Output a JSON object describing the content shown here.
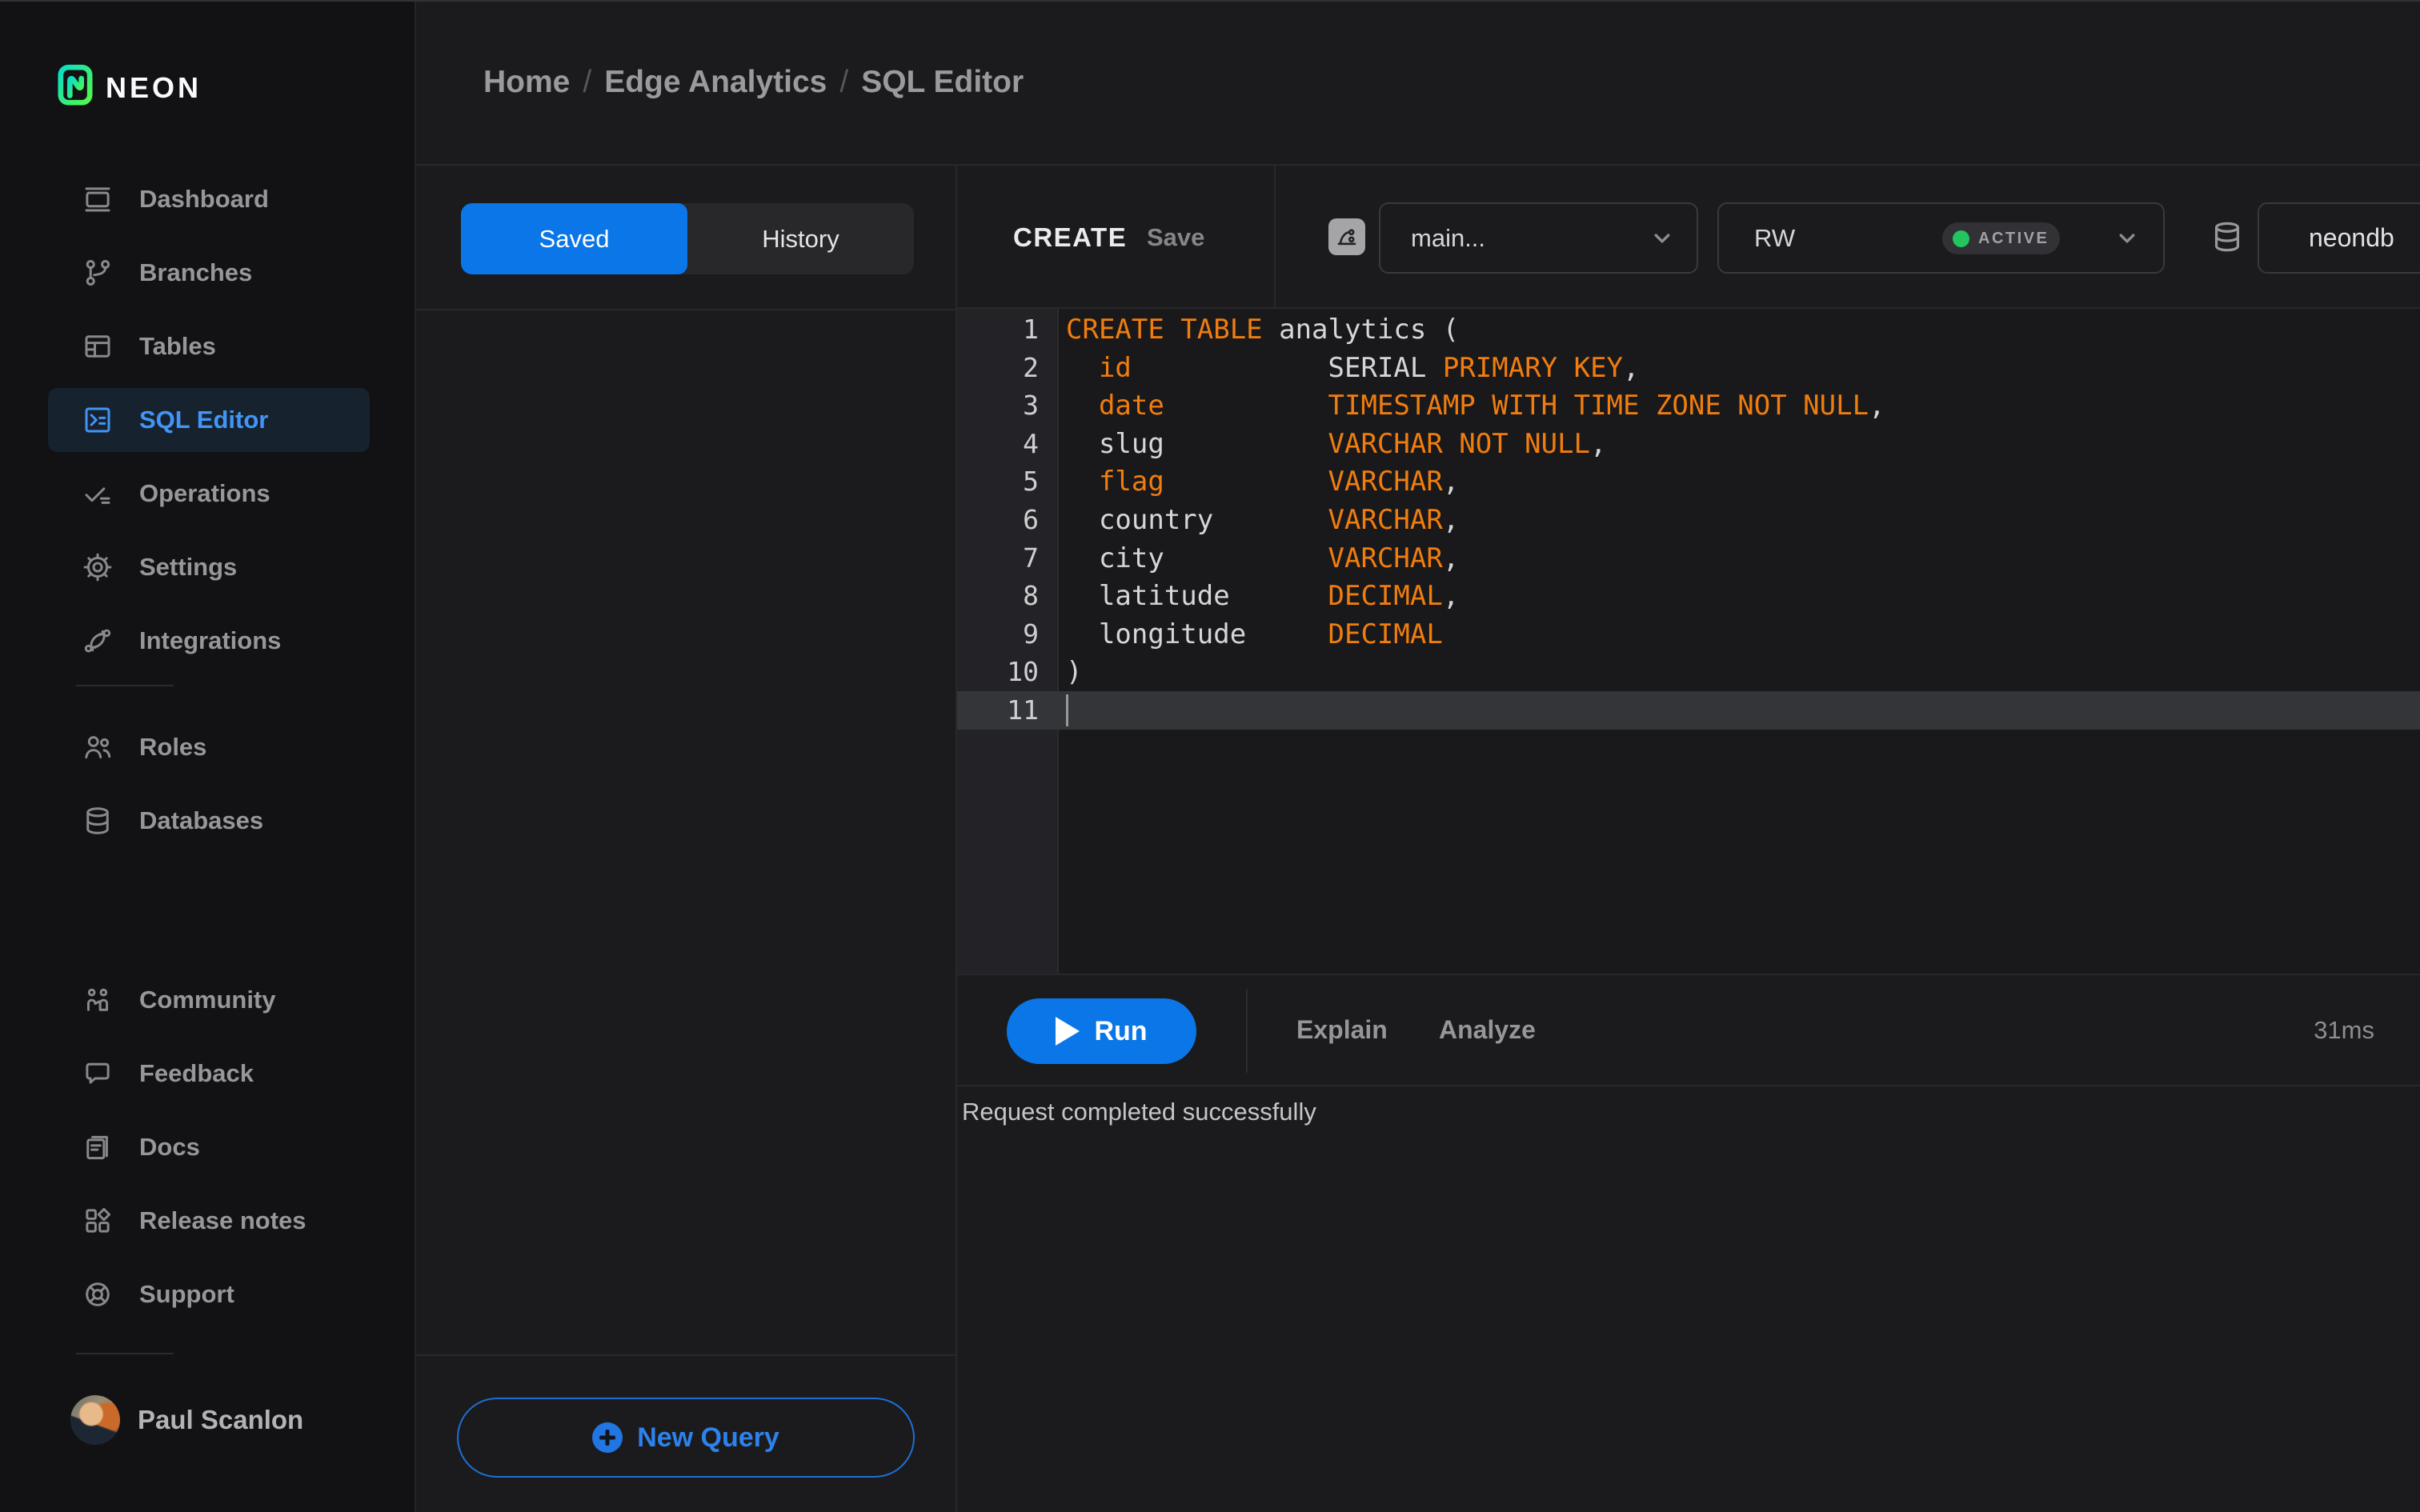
{
  "brand": {
    "name": "NEON"
  },
  "breadcrumb": {
    "separator": "/",
    "items": [
      "Home",
      "Edge Analytics",
      "SQL Editor"
    ]
  },
  "sidebar": {
    "groups": [
      {
        "items": [
          {
            "icon": "dashboard",
            "label": "Dashboard",
            "selected": false
          },
          {
            "icon": "git-branch",
            "label": "Branches",
            "selected": false
          },
          {
            "icon": "table",
            "label": "Tables",
            "selected": false
          },
          {
            "icon": "terminal",
            "label": "SQL Editor",
            "selected": true
          },
          {
            "icon": "check-list",
            "label": "Operations",
            "selected": false
          },
          {
            "icon": "gear",
            "label": "Settings",
            "selected": false
          },
          {
            "icon": "sync-nodes",
            "label": "Integrations",
            "selected": false
          }
        ]
      },
      {
        "items": [
          {
            "icon": "users",
            "label": "Roles",
            "selected": false
          },
          {
            "icon": "database",
            "label": "Databases",
            "selected": false
          }
        ]
      },
      {
        "items": [
          {
            "icon": "community",
            "label": "Community",
            "selected": false
          },
          {
            "icon": "speech-bubble",
            "label": "Feedback",
            "selected": false
          },
          {
            "icon": "document",
            "label": "Docs",
            "selected": false
          },
          {
            "icon": "grid-tiles",
            "label": "Release notes",
            "selected": false
          },
          {
            "icon": "life-buoy",
            "label": "Support",
            "selected": false
          }
        ]
      }
    ],
    "user": {
      "name": "Paul Scanlon"
    }
  },
  "left_panel": {
    "tabs": [
      {
        "label": "Saved",
        "active": true
      },
      {
        "label": "History",
        "active": false
      }
    ],
    "new_query_label": "New Query"
  },
  "toolbar": {
    "query_tab": "CREATE",
    "save_label": "Save",
    "branch": "main...",
    "compute": "RW",
    "compute_status": "ACTIVE",
    "database": "neondb"
  },
  "editor": {
    "lines": [
      {
        "no": 1,
        "segments": [
          {
            "text": "CREATE TABLE",
            "type": "kw"
          },
          {
            "text": " analytics (",
            "type": "pl"
          }
        ]
      },
      {
        "no": 2,
        "segments": [
          {
            "text": "  ",
            "type": "pl"
          },
          {
            "text": "id",
            "type": "kw"
          },
          {
            "text": "            ",
            "type": "pl"
          },
          {
            "text": "SERIAL ",
            "type": "pl"
          },
          {
            "text": "PRIMARY KEY",
            "type": "kw"
          },
          {
            "text": ",",
            "type": "pl"
          }
        ]
      },
      {
        "no": 3,
        "segments": [
          {
            "text": "  ",
            "type": "pl"
          },
          {
            "text": "date",
            "type": "kw"
          },
          {
            "text": "          ",
            "type": "pl"
          },
          {
            "text": "TIMESTAMP WITH TIME ZONE NOT NULL",
            "type": "kw"
          },
          {
            "text": ",",
            "type": "pl"
          }
        ]
      },
      {
        "no": 4,
        "segments": [
          {
            "text": "  slug          ",
            "type": "pl"
          },
          {
            "text": "VARCHAR NOT NULL",
            "type": "kw"
          },
          {
            "text": ",",
            "type": "pl"
          }
        ]
      },
      {
        "no": 5,
        "segments": [
          {
            "text": "  ",
            "type": "pl"
          },
          {
            "text": "flag",
            "type": "kw"
          },
          {
            "text": "          ",
            "type": "pl"
          },
          {
            "text": "VARCHAR",
            "type": "kw"
          },
          {
            "text": ",",
            "type": "pl"
          }
        ]
      },
      {
        "no": 6,
        "segments": [
          {
            "text": "  country       ",
            "type": "pl"
          },
          {
            "text": "VARCHAR",
            "type": "kw"
          },
          {
            "text": ",",
            "type": "pl"
          }
        ]
      },
      {
        "no": 7,
        "segments": [
          {
            "text": "  city          ",
            "type": "pl"
          },
          {
            "text": "VARCHAR",
            "type": "kw"
          },
          {
            "text": ",",
            "type": "pl"
          }
        ]
      },
      {
        "no": 8,
        "segments": [
          {
            "text": "  latitude      ",
            "type": "pl"
          },
          {
            "text": "DECIMAL",
            "type": "kw"
          },
          {
            "text": ",",
            "type": "pl"
          }
        ]
      },
      {
        "no": 9,
        "segments": [
          {
            "text": "  longitude     ",
            "type": "pl"
          },
          {
            "text": "DECIMAL",
            "type": "kw"
          }
        ]
      },
      {
        "no": 10,
        "segments": [
          {
            "text": ")",
            "type": "pl"
          }
        ]
      },
      {
        "no": 11,
        "segments": []
      }
    ],
    "current_line": 11
  },
  "run_bar": {
    "run_label": "Run",
    "explain_label": "Explain",
    "analyze_label": "Analyze",
    "duration": "31ms"
  },
  "status": {
    "message": "Request completed successfully"
  },
  "colors": {
    "accent_blue": "#0a76e7",
    "code_orange": "#f07d0e",
    "active_green": "#22c55e",
    "brand_green_start": "#0adec6",
    "brand_green_end": "#52f948"
  }
}
